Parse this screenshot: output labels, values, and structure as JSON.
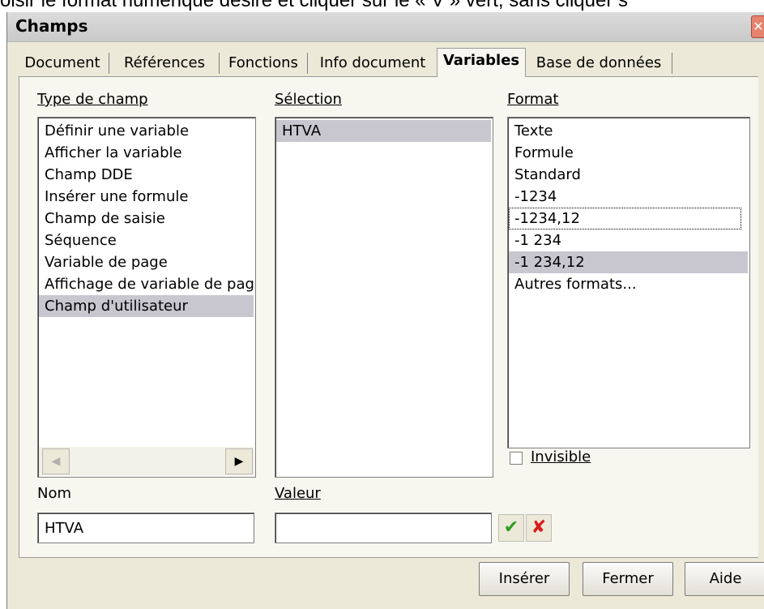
{
  "caption": "oisir le format numérique désiré et cliquer sur le « V » vert, sans cliquer s",
  "dialog": {
    "title": "Champs",
    "close_glyph": "✕",
    "tabs": [
      "Document",
      "Références",
      "Fonctions",
      "Info document",
      "Variables",
      "Base de données"
    ],
    "active_tab": "Variables",
    "type_label": "Type de champ",
    "type_items": [
      "Définir une variable",
      "Afficher la variable",
      "Champ DDE",
      "Insérer une formule",
      "Champ de saisie",
      "Séquence",
      "Variable de page",
      "Affichage de variable de pag",
      "Champ d'utilisateur"
    ],
    "type_selected": "Champ d'utilisateur",
    "selection_label": "Sélection",
    "selection_items": [
      "HTVA"
    ],
    "format_label": "Format",
    "format_items": [
      "Texte",
      "Formule",
      "Standard",
      "-1234",
      "-1234,12",
      "-1 234",
      "-1 234,12",
      "Autres formats..."
    ],
    "format_selected": "-1 234,12",
    "format_focused": "-1234,12",
    "invisible_label": "Invisible",
    "invisible_checked": false,
    "nom_label": "Nom",
    "nom_value": "HTVA",
    "valeur_label": "Valeur",
    "valeur_value": "",
    "apply_glyph": "✔",
    "delete_glyph": "✘",
    "buttons": {
      "insert": "Insérer",
      "close": "Fermer",
      "help": "Aide"
    },
    "colors": {
      "apply": "#2e9e1e",
      "delete": "#d81c1c",
      "selection": "#c8c7d0"
    }
  }
}
